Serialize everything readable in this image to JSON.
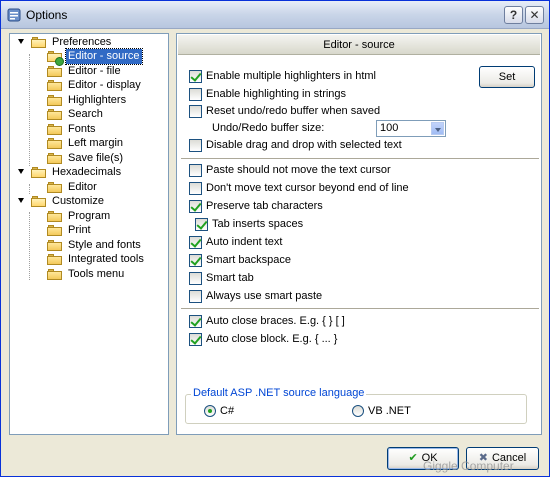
{
  "window": {
    "title": "Options",
    "help_label": "?",
    "close_label": "✕"
  },
  "tree": {
    "items": [
      {
        "label": "Preferences",
        "level": 0,
        "open": true
      },
      {
        "label": "Editor - source",
        "level": 1,
        "selected": true
      },
      {
        "label": "Editor - file",
        "level": 1
      },
      {
        "label": "Editor - display",
        "level": 1
      },
      {
        "label": "Highlighters",
        "level": 1
      },
      {
        "label": "Search",
        "level": 1
      },
      {
        "label": "Fonts",
        "level": 1
      },
      {
        "label": "Left margin",
        "level": 1
      },
      {
        "label": "Save file(s)",
        "level": 1
      },
      {
        "label": "Hexadecimals",
        "level": 0,
        "open": true
      },
      {
        "label": "Editor",
        "level": 1
      },
      {
        "label": "Customize",
        "level": 0,
        "open": true
      },
      {
        "label": "Program",
        "level": 1
      },
      {
        "label": "Print",
        "level": 1
      },
      {
        "label": "Style and fonts",
        "level": 1
      },
      {
        "label": "Integrated tools",
        "level": 1
      },
      {
        "label": "Tools menu",
        "level": 1
      }
    ]
  },
  "panel": {
    "header": "Editor - source",
    "set_button": "Set",
    "buffer_size_label": "Undo/Redo buffer size:",
    "buffer_size_value": "100",
    "options": [
      {
        "label": "Enable multiple highlighters in html",
        "checked": true
      },
      {
        "label": "Enable highlighting in strings",
        "checked": false
      },
      {
        "label": "Reset undo/redo buffer when saved",
        "checked": false
      },
      {
        "label": "Disable drag and drop with selected text",
        "checked": false
      },
      {
        "label": "Paste should not move the text cursor",
        "checked": false
      },
      {
        "label": "Don't move text cursor beyond end of line",
        "checked": false
      },
      {
        "label": "Preserve tab characters",
        "checked": true
      },
      {
        "label": "Tab inserts spaces",
        "checked": true
      },
      {
        "label": "Auto indent text",
        "checked": true
      },
      {
        "label": "Smart backspace",
        "checked": true
      },
      {
        "label": "Smart tab",
        "checked": false
      },
      {
        "label": "Always use smart paste",
        "checked": false
      },
      {
        "label": "Auto close braces. E.g. { } [ ]",
        "checked": true
      },
      {
        "label": "Auto close block. E.g. { ... }",
        "checked": true
      }
    ],
    "language_group": {
      "title": "Default ASP .NET source language",
      "options": [
        {
          "label": "C#",
          "selected": true
        },
        {
          "label": "VB .NET",
          "selected": false
        }
      ]
    }
  },
  "buttons": {
    "ok": "OK",
    "cancel": "Cancel",
    "ok_icon": "✔",
    "cancel_icon": "✖"
  },
  "watermark": "Giggle Computer"
}
